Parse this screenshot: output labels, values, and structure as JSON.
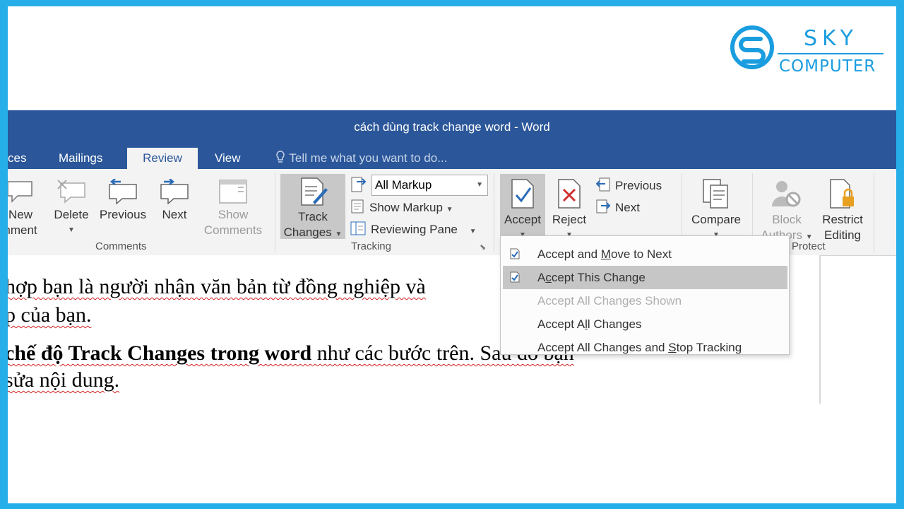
{
  "logo": {
    "line1": "SKY",
    "line2": "COMPUTER"
  },
  "window": {
    "title": "cách dùng track change word - Word"
  },
  "tabs": [
    {
      "label": "ces"
    },
    {
      "label": "Mailings"
    },
    {
      "label": "Review"
    },
    {
      "label": "View"
    }
  ],
  "tell_me": "Tell me what you want to do...",
  "ribbon": {
    "comments": {
      "new_line1": "New",
      "new_line2": "nment",
      "delete": "Delete",
      "previous": "Previous",
      "next": "Next",
      "show_line1": "Show",
      "show_line2": "Comments",
      "group": "Comments"
    },
    "tracking": {
      "track_line1": "Track",
      "track_line2": "Changes",
      "markup_select": "All Markup",
      "show_markup": "Show Markup",
      "reviewing_pane": "Reviewing Pane",
      "group": "Tracking"
    },
    "changes": {
      "accept": "Accept",
      "reject": "Reject",
      "previous": "Previous",
      "next": "Next"
    },
    "compare": {
      "label": "Compare"
    },
    "protect": {
      "block_line1": "Block",
      "block_line2": "Authors",
      "restrict_line1": "Restrict",
      "restrict_line2": "Editing",
      "group": "Protect"
    }
  },
  "accept_menu": {
    "items": [
      {
        "pre": "Accept and ",
        "key": "M",
        "post": "ove to Next",
        "enabled": true,
        "highlighted": false,
        "icon": "check-icon"
      },
      {
        "pre": "A",
        "key": "c",
        "post": "cept This Change",
        "enabled": true,
        "highlighted": true,
        "icon": "check-icon"
      },
      {
        "pre": "Accept All Changes Shown",
        "key": "",
        "post": "",
        "enabled": false,
        "highlighted": false,
        "icon": ""
      },
      {
        "pre": "Accept A",
        "key": "l",
        "post": "l Changes",
        "enabled": true,
        "highlighted": false,
        "icon": ""
      },
      {
        "pre": "Accept All Changes and ",
        "key": "S",
        "post": "top Tracking",
        "enabled": true,
        "highlighted": false,
        "icon": ""
      }
    ]
  },
  "document": {
    "line1": "hợp bạn là người nhận văn bản từ đồng nghiệp và",
    "line2": "p của bạn.",
    "line3_bold": "chế độ Track Changes trong word",
    "line3_rest": " như các bước trên. Sau đó bạn",
    "line4": " sửa nội dung."
  },
  "colors": {
    "accent": "#2b579a",
    "frame": "#26aee8",
    "logo": "#1a9ddf"
  }
}
